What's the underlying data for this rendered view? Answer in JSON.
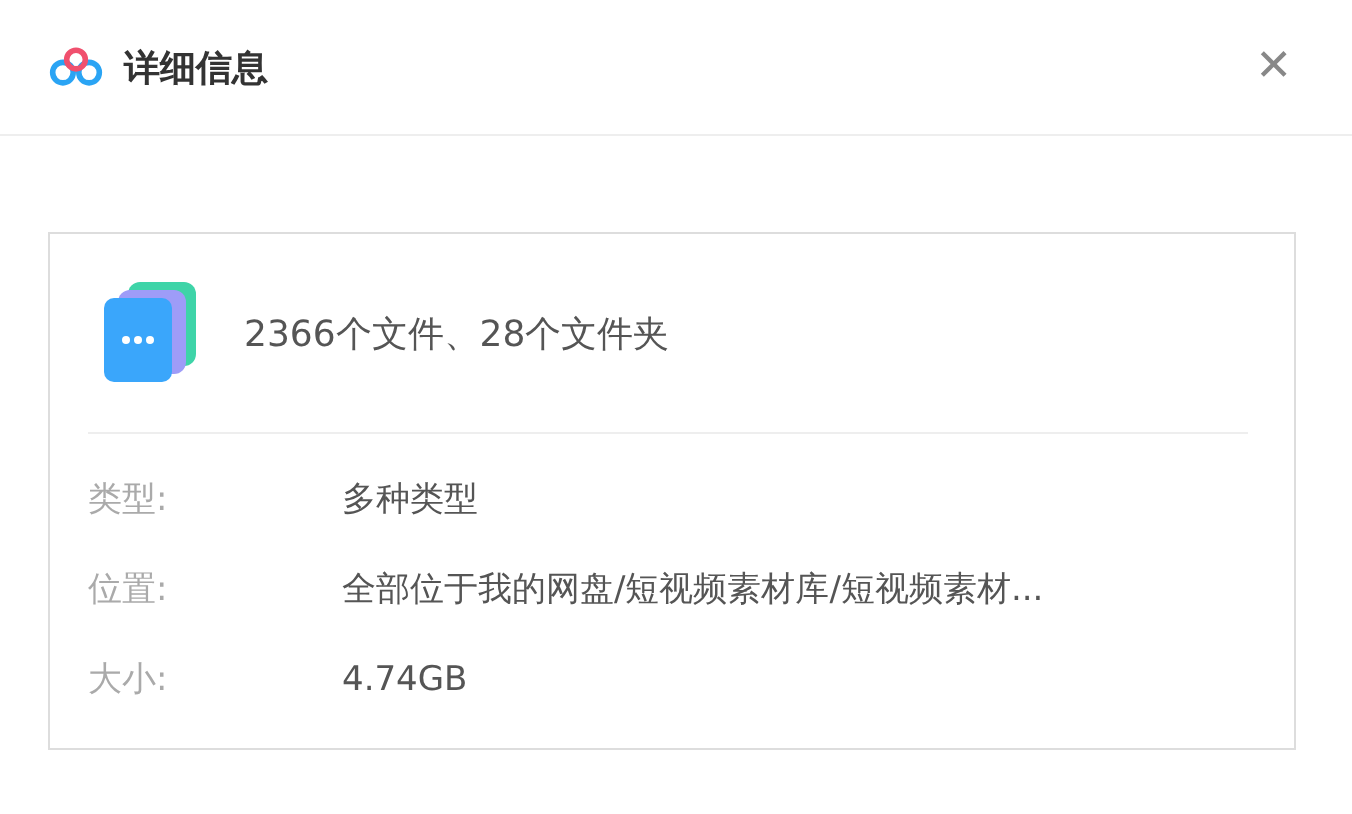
{
  "window": {
    "title": "详细信息",
    "close": "✕"
  },
  "summary": "2366个文件、28个文件夹",
  "details": [
    {
      "label": "类型:",
      "value": "多种类型"
    },
    {
      "label": "位置:",
      "value": "全部位于我的网盘/短视频素材库/短视频素材..."
    },
    {
      "label": "大小:",
      "value": "4.74GB"
    }
  ]
}
